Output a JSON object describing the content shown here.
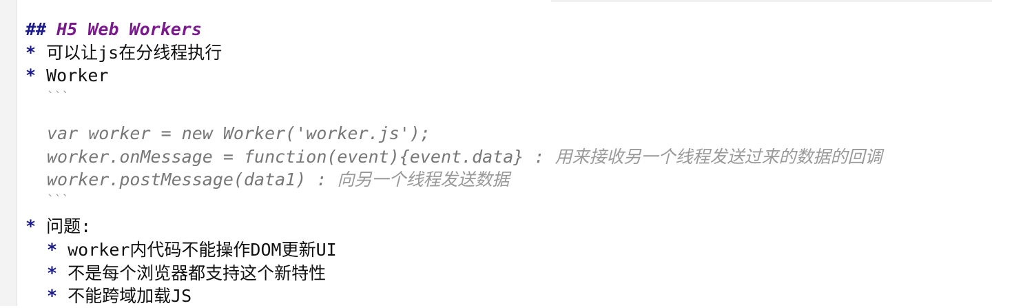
{
  "heading": {
    "marker": "##",
    "text": "H5 Web Workers"
  },
  "bullet": "*",
  "items": [
    "可以让js在分线程执行",
    "Worker"
  ],
  "code_fence": "```",
  "code_lines": [
    {
      "code": "var worker = new Worker('worker.js');",
      "comment": ""
    },
    {
      "code": "worker.onMessage = function(event){event.data} :",
      "comment": "用来接收另一个线程发送过来的数据的回调"
    },
    {
      "code": "worker.postMessage(data1) :",
      "comment": "向另一个线程发送数据"
    }
  ],
  "problems": {
    "label": "问题:",
    "items": [
      "worker内代码不能操作DOM更新UI",
      "不是每个浏览器都支持这个新特性",
      "不能跨域加载JS"
    ]
  }
}
